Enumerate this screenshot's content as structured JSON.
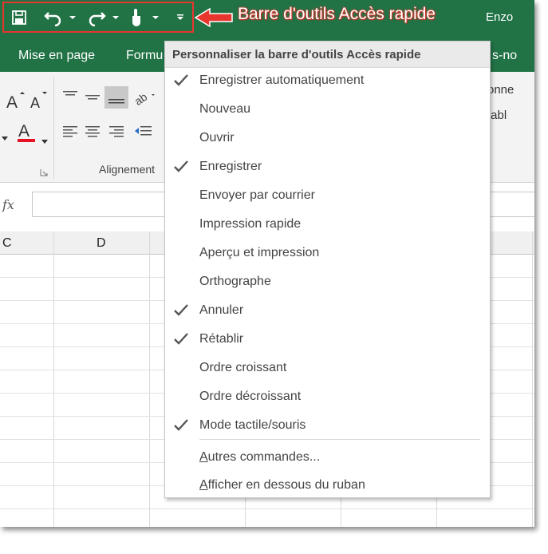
{
  "callout": {
    "text": "Barre d'outils Accès rapide"
  },
  "user": {
    "name": "Enzo"
  },
  "tabs": [
    {
      "label": "Mise en page"
    },
    {
      "label": "Formu"
    },
    {
      "label": "s-no"
    }
  ],
  "ribbon": {
    "group_alignment_label": "Alignement",
    "right_partial_1": "onne",
    "right_partial_2": "tabl"
  },
  "formula_bar": {
    "fx_label": "fx",
    "value": ""
  },
  "columns": [
    "C",
    "D"
  ],
  "menu": {
    "title": "Personnaliser la barre d'outils Accès rapide",
    "items": [
      {
        "label": "Enregistrer automatiquement",
        "checked": true
      },
      {
        "label": "Nouveau",
        "checked": false
      },
      {
        "label": "Ouvrir",
        "checked": false
      },
      {
        "label": "Enregistrer",
        "checked": true
      },
      {
        "label": "Envoyer par courrier",
        "checked": false
      },
      {
        "label": "Impression rapide",
        "checked": false
      },
      {
        "label": "Aperçu et impression",
        "checked": false
      },
      {
        "label": "Orthographe",
        "checked": false
      },
      {
        "label": "Annuler",
        "checked": true
      },
      {
        "label": "Rétablir",
        "checked": true
      },
      {
        "label": "Ordre croissant",
        "checked": false
      },
      {
        "label": "Ordre décroissant",
        "checked": false
      },
      {
        "label": "Mode tactile/souris",
        "checked": true
      }
    ],
    "more_commands": {
      "first": "A",
      "rest": "utres commandes..."
    },
    "show_below": {
      "first": "A",
      "rest": "fficher en dessous du ruban"
    }
  },
  "colors": {
    "excel_green": "#217346",
    "callout_red": "#e8362f"
  }
}
